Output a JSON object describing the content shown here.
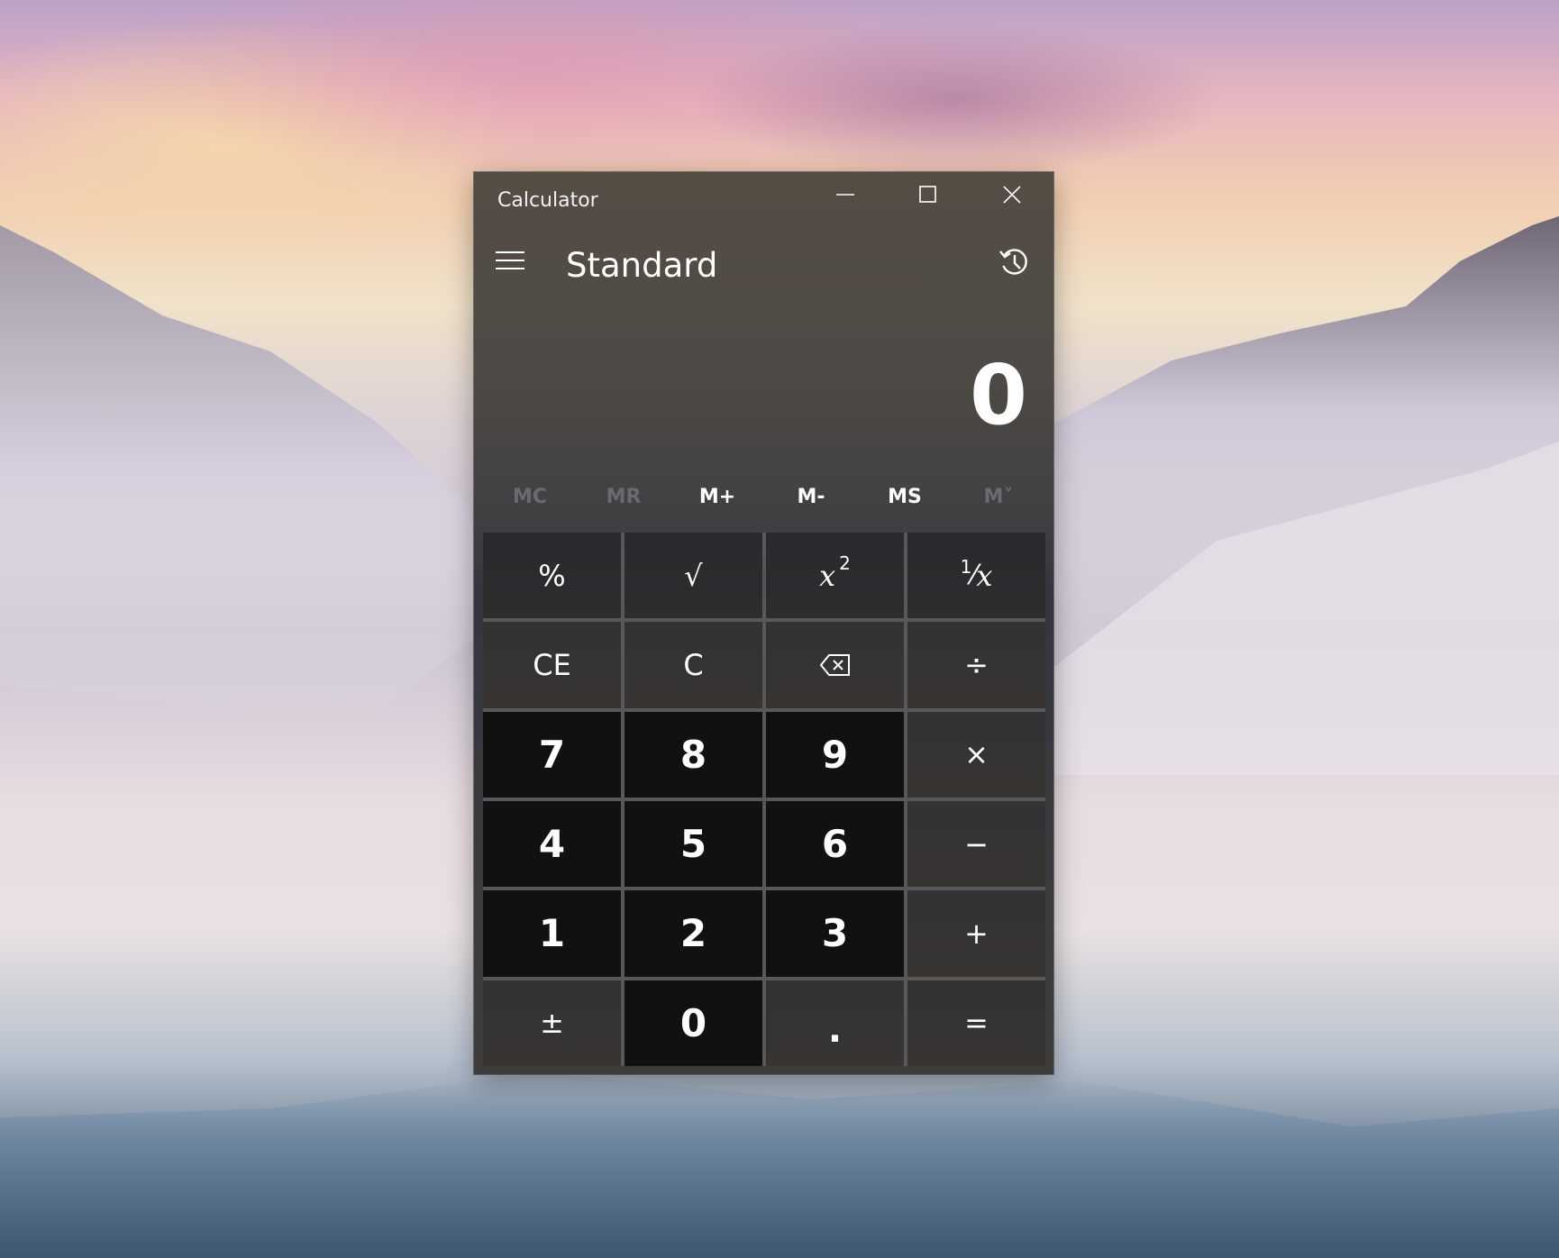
{
  "window": {
    "title": "Calculator",
    "controls": {
      "minimize": "minimize-icon",
      "maximize": "maximize-icon",
      "close": "close-icon"
    }
  },
  "header": {
    "menu_icon": "hamburger-icon",
    "mode": "Standard",
    "history_icon": "history-icon"
  },
  "display": {
    "value": "0"
  },
  "memory": [
    {
      "label": "MC",
      "enabled": false
    },
    {
      "label": "MR",
      "enabled": false
    },
    {
      "label": "M+",
      "enabled": true
    },
    {
      "label": "M-",
      "enabled": true
    },
    {
      "label": "MS",
      "enabled": true
    },
    {
      "label": "M˅",
      "enabled": false
    }
  ],
  "keys": {
    "percent": "%",
    "sqrt": "√",
    "square_base": "x",
    "square_exp": "2",
    "reciprocal_num": "1",
    "reciprocal_den": "x",
    "ce": "CE",
    "c": "C",
    "backspace": "backspace-icon",
    "divide": "÷",
    "seven": "7",
    "eight": "8",
    "nine": "9",
    "multiply": "×",
    "four": "4",
    "five": "5",
    "six": "6",
    "minus": "−",
    "one": "1",
    "two": "2",
    "three": "3",
    "plus": "+",
    "negate": "±",
    "zero": "0",
    "decimal": ".",
    "equals": "="
  },
  "colors": {
    "number_key": "#121011",
    "operator_key": "#353333",
    "function_key": "#2b2b2f",
    "grid_gap": "#58575a",
    "disabled_text": "#6a6b70"
  }
}
